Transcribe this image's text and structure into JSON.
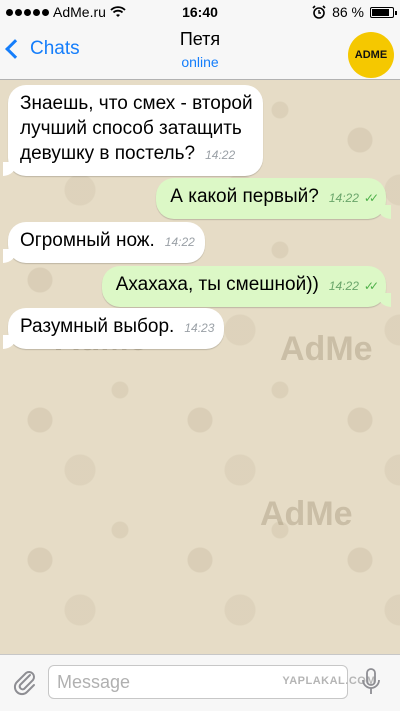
{
  "status_bar": {
    "carrier": "AdMe.ru",
    "time": "16:40",
    "battery_percent": "86 %",
    "battery_level": 0.86
  },
  "nav": {
    "back_label": "Chats",
    "contact_name": "Петя",
    "contact_status": "online",
    "avatar_text": "ADME"
  },
  "messages": [
    {
      "direction": "in",
      "text_lines": [
        "Знаешь, что смех - второй",
        "лучший способ затащить",
        "девушку в постель?"
      ],
      "time": "14:22"
    },
    {
      "direction": "out",
      "text": "А какой первый?",
      "time": "14:22",
      "read": true
    },
    {
      "direction": "in",
      "text": "Огромный нож.",
      "time": "14:22"
    },
    {
      "direction": "out",
      "text": "Ахахаха, ты смешной))",
      "time": "14:22",
      "read": true
    },
    {
      "direction": "in",
      "text": "Разумный выбор.",
      "time": "14:23"
    }
  ],
  "watermarks": {
    "chat": "AdMe",
    "footer": "YAPLAKAL.COM"
  },
  "input": {
    "placeholder": "Message"
  },
  "icons": [
    "wifi-icon",
    "alarm-icon",
    "battery-icon",
    "attach-icon",
    "mic-icon",
    "double-check-icon"
  ],
  "colors": {
    "accent": "#157efb",
    "outgoing_bubble": "#dcf8c6",
    "incoming_bubble": "#ffffff",
    "read_ticks": "#4fb14a",
    "avatar_bg": "#f5c800"
  }
}
